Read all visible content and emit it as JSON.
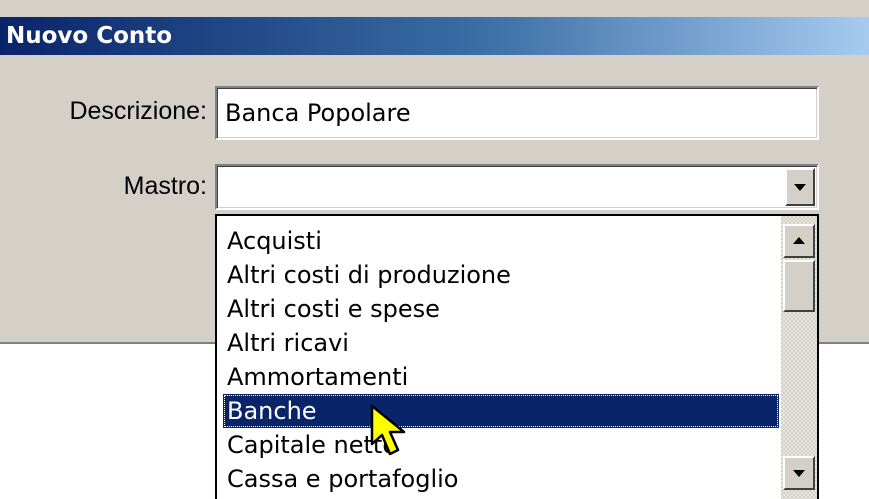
{
  "window": {
    "title": "Nuovo Conto"
  },
  "form": {
    "descrizione_label": "Descrizione:",
    "descrizione_value": "Banca Popolare",
    "mastro_label": "Mastro:",
    "mastro_value": ""
  },
  "dropdown": {
    "items": [
      "Acquisti",
      "Altri costi di produzione",
      "Altri costi e spese",
      "Altri ricavi",
      "Ammortamenti",
      "Banche",
      "Capitale netto",
      "Cassa e portafoglio"
    ],
    "selected_item": "Banche",
    "selected_color": "#0a246a"
  },
  "icons": {
    "combo_button": "chevron-down-icon",
    "scroll_up": "arrow-up-icon",
    "scroll_down": "arrow-down-icon",
    "pointer": "mouse-pointer-icon"
  }
}
